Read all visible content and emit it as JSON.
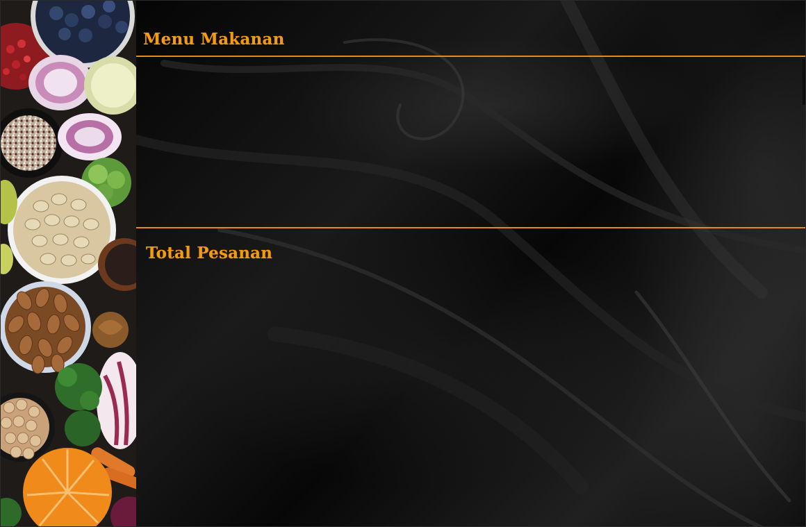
{
  "window": {
    "menu_title": "Menu Makanan",
    "total_title": "Total Pesanan"
  },
  "theme": {
    "accent": "#f39c12",
    "divider": "#e8891a",
    "background": "#000000"
  }
}
